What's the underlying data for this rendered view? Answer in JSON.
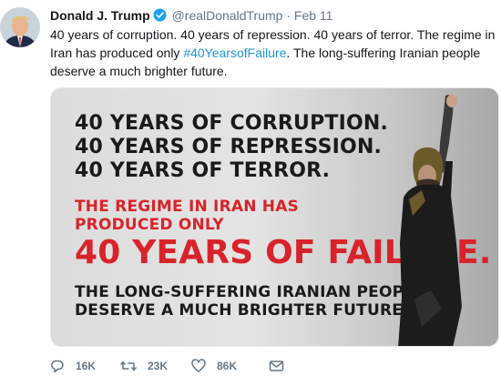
{
  "tweet": {
    "author_name": "Donald J. Trump",
    "handle": "@realDonaldTrump",
    "separator": "·",
    "date": "Feb 11",
    "text_before_hashtag": "40 years of corruption. 40 years of repression. 40 years of terror. The regime in Iran has produced only ",
    "hashtag": "#40YearsofFailure",
    "text_after_hashtag": ". The long-suffering Iranian people deserve a much brighter future."
  },
  "media": {
    "line1": "40 YEARS OF CORRUPTION.",
    "line2": "40 YEARS OF REPRESSION.",
    "line3": "40 YEARS OF TERROR.",
    "line4": "THE REGIME IN IRAN HAS",
    "line5": "PRODUCED ONLY",
    "line6": "40 YEARS OF FAILURE.",
    "line7": "THE LONG-SUFFERING IRANIAN PEOPLE",
    "line8": "DESERVE A MUCH BRIGHTER FUTURE."
  },
  "actions": {
    "reply_count": "16K",
    "retweet_count": "23K",
    "like_count": "86K"
  },
  "colors": {
    "link": "#1b95e0",
    "muted": "#657786",
    "verified": "#1da1f2",
    "accent_red": "#d8232a"
  },
  "icons": [
    "verified-badge-icon",
    "reply-icon",
    "retweet-icon",
    "like-icon",
    "direct-message-icon"
  ]
}
